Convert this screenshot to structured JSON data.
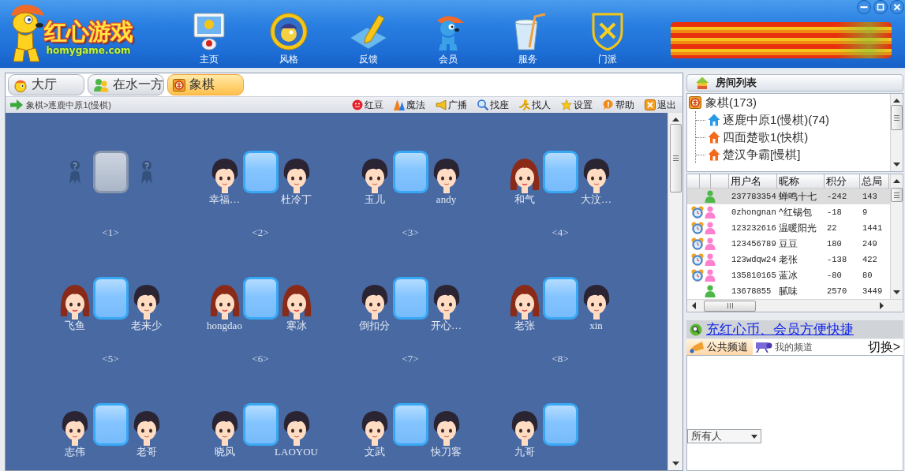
{
  "header": {
    "logo": {
      "title": "红心游戏",
      "subtitle": "homygame.com"
    },
    "nav": [
      {
        "label": "主页",
        "kind": "monitor"
      },
      {
        "label": "风格",
        "kind": "badge"
      },
      {
        "label": "反馈",
        "kind": "pencil"
      },
      {
        "label": "会员",
        "kind": "mascot"
      },
      {
        "label": "服务",
        "kind": "cup"
      },
      {
        "label": "门派",
        "kind": "shield"
      }
    ]
  },
  "lobby": {
    "tabs": [
      {
        "label": "大厅",
        "kind": "hall",
        "selected": false
      },
      {
        "label": "在水一方",
        "kind": "friends",
        "selected": false
      },
      {
        "label": "象棋",
        "kind": "chess",
        "selected": true
      }
    ],
    "breadcrumb": "象棋>逐鹿中原1(慢棋)",
    "toolbar": [
      {
        "label": "红豆",
        "kind": "bean"
      },
      {
        "label": "魔法",
        "kind": "magic"
      },
      {
        "label": "广播",
        "kind": "broadcast"
      },
      {
        "label": "找座",
        "kind": "find-seat"
      },
      {
        "label": "找人",
        "kind": "find-person"
      },
      {
        "label": "设置",
        "kind": "settings"
      },
      {
        "label": "帮助",
        "kind": "help"
      },
      {
        "label": "退出",
        "kind": "exit"
      }
    ],
    "tables": [
      {
        "number": "<1>",
        "occupied": false,
        "seats": [
          {
            "kind": "empty"
          },
          {
            "kind": "empty"
          }
        ]
      },
      {
        "number": "<2>",
        "occupied": true,
        "seats": [
          {
            "kind": "boy",
            "name": "幸福…"
          },
          {
            "kind": "boy",
            "name": "杜冷丁"
          }
        ]
      },
      {
        "number": "<3>",
        "occupied": true,
        "seats": [
          {
            "kind": "boy",
            "name": "玉儿"
          },
          {
            "kind": "boy",
            "name": "andy"
          }
        ]
      },
      {
        "number": "<4>",
        "occupied": true,
        "seats": [
          {
            "kind": "girl",
            "name": "和气"
          },
          {
            "kind": "boy",
            "name": "大汶…"
          }
        ]
      },
      {
        "number": "<5>",
        "occupied": true,
        "seats": [
          {
            "kind": "girl",
            "name": "飞鱼"
          },
          {
            "kind": "boy",
            "name": "老来少"
          }
        ]
      },
      {
        "number": "<6>",
        "occupied": true,
        "seats": [
          {
            "kind": "girl",
            "name": "hongdao"
          },
          {
            "kind": "girl",
            "name": "寒冰"
          }
        ]
      },
      {
        "number": "<7>",
        "occupied": true,
        "seats": [
          {
            "kind": "boy",
            "name": "倒扣分"
          },
          {
            "kind": "boy",
            "name": "开心…"
          }
        ]
      },
      {
        "number": "<8>",
        "occupied": true,
        "seats": [
          {
            "kind": "girl",
            "name": "老张"
          },
          {
            "kind": "boy",
            "name": "xin"
          }
        ]
      },
      {
        "occupied": true,
        "seats": [
          {
            "kind": "boy",
            "name": "志伟"
          },
          {
            "kind": "boy",
            "name": "老哥"
          }
        ]
      },
      {
        "occupied": true,
        "seats": [
          {
            "kind": "boy",
            "name": "晓风"
          },
          {
            "kind": "boy",
            "name": "LAOYOU"
          }
        ]
      },
      {
        "occupied": true,
        "seats": [
          {
            "kind": "boy",
            "name": "文武"
          },
          {
            "kind": "boy",
            "name": "快刀客"
          }
        ]
      },
      {
        "occupied": true,
        "seats": [
          {
            "kind": "boy",
            "name": "九哥"
          }
        ]
      }
    ]
  },
  "room_list": {
    "title": "房间列表",
    "tree": [
      {
        "label": "象棋(173)",
        "kind": "game",
        "children": [
          {
            "label": "逐鹿中原1(慢棋)(74)",
            "kind": "room",
            "selected": true
          },
          {
            "label": "四面楚歌1(快棋)",
            "kind": "room",
            "selected": false
          },
          {
            "label": "楚汉争霸[慢棋]",
            "kind": "room",
            "selected": false
          }
        ]
      }
    ]
  },
  "users": {
    "columns": [
      "用户名",
      "昵称",
      "积分",
      "总局"
    ],
    "rows": [
      {
        "clock": false,
        "color": "#4cb848",
        "username": "237783354",
        "nickname": "蝉鸣十七",
        "score": "-242",
        "games": "143",
        "selected": true
      },
      {
        "clock": true,
        "color": "#ff7fd0",
        "username": "0zhongnan",
        "nickname": "^红锡包",
        "score": "-18",
        "games": "9",
        "selected": false
      },
      {
        "clock": true,
        "color": "#ff7fd0",
        "username": "123232616",
        "nickname": "温暖阳光",
        "score": "22",
        "games": "1441",
        "selected": false
      },
      {
        "clock": true,
        "color": "#ff7fd0",
        "username": "123456789",
        "nickname": "豆豆",
        "score": "180",
        "games": "249",
        "selected": false
      },
      {
        "clock": true,
        "color": "#ff7fd0",
        "username": "123wdqw24",
        "nickname": "老张",
        "score": "-138",
        "games": "422",
        "selected": false
      },
      {
        "clock": true,
        "color": "#ff7fd0",
        "username": "135810165",
        "nickname": "蓝冰",
        "score": "-80",
        "games": "80",
        "selected": false
      },
      {
        "clock": false,
        "color": "#4cb848",
        "username": "13678855",
        "nickname": "腻味",
        "score": "2570",
        "games": "3449",
        "selected": false
      }
    ]
  },
  "promo_link": "充红心币、会员方便快捷",
  "channels": {
    "tabs": [
      {
        "label": "公共频道",
        "kind": "public",
        "selected": true
      },
      {
        "label": "我的频道",
        "kind": "mine",
        "selected": false
      }
    ],
    "switch": "切换>"
  },
  "chat": {
    "recipient": "所有人"
  }
}
